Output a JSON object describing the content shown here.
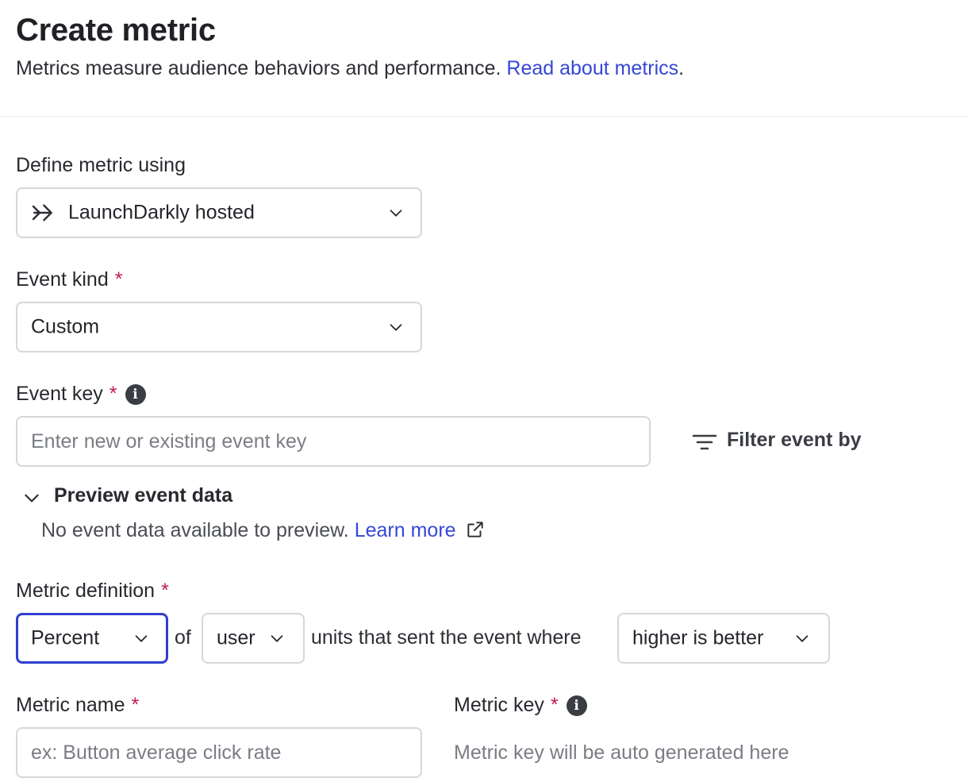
{
  "header": {
    "title": "Create metric",
    "subtitle": "Metrics measure audience behaviors and performance.",
    "link": "Read about metrics",
    "link_suffix": "."
  },
  "define_metric": {
    "label": "Define metric using",
    "value": "LaunchDarkly hosted",
    "icon": "arrow-right-icon"
  },
  "event_kind": {
    "label": "Event kind",
    "required": "*",
    "value": "Custom"
  },
  "event_key": {
    "label": "Event key",
    "required": "*",
    "info": "i",
    "placeholder": "Enter new or existing event key",
    "filter_label": "Filter event by"
  },
  "preview": {
    "label": "Preview event data",
    "message": "No event data available to preview.",
    "learn_more": "Learn more"
  },
  "metric_definition": {
    "label": "Metric definition",
    "required": "*",
    "measure": "Percent",
    "of": "of",
    "unit": "user",
    "middle_text": "units that sent the event where",
    "direction": "higher is better"
  },
  "metric_name": {
    "label": "Metric name",
    "required": "*",
    "placeholder": "ex: Button average click rate"
  },
  "metric_key": {
    "label": "Metric key",
    "required": "*",
    "info": "i",
    "placeholder": "Metric key will be auto generated here"
  },
  "colors": {
    "accent": "#3547d6",
    "required": "#c2185b",
    "border": "#d5d7dc",
    "focus": "#2f3fcf"
  }
}
